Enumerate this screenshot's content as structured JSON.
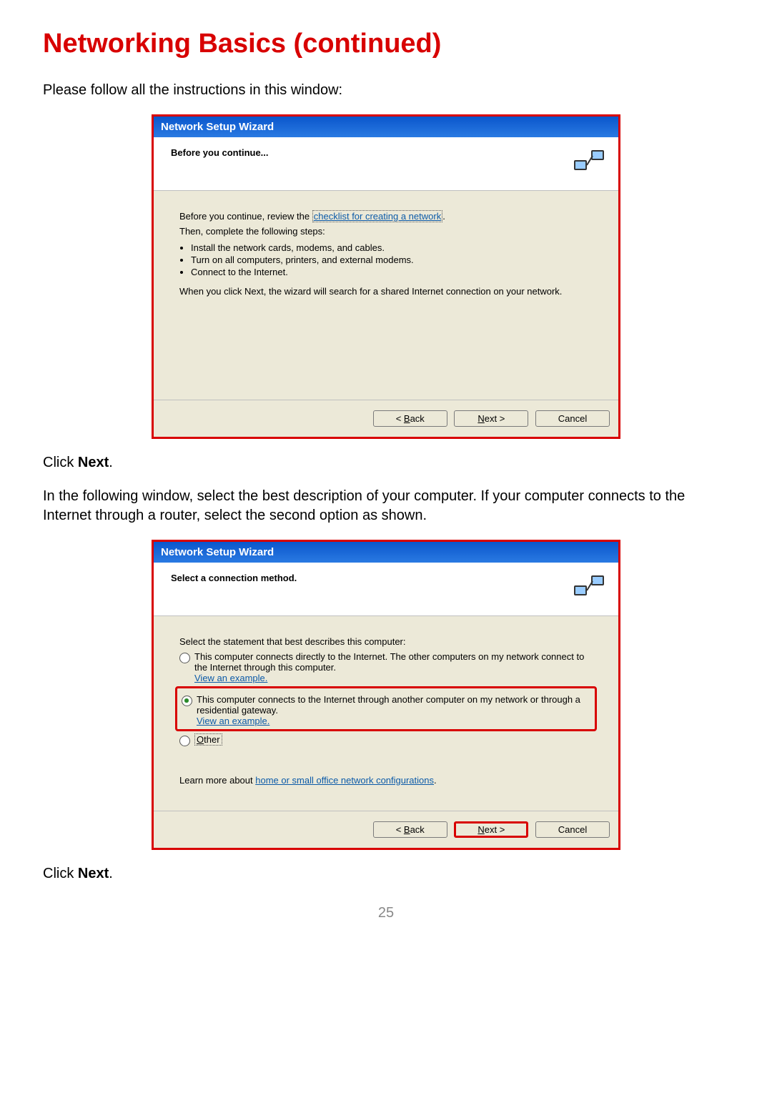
{
  "page": {
    "title": "Networking Basics (continued)",
    "intro": "Please follow all the instructions in this window:",
    "click_next_1": "Click ",
    "click_next_bold": "Next",
    "click_next_period": ".",
    "para2": "In the following window, select the best description of your computer. If your computer connects to the Internet through a router, select the second option as shown.",
    "page_number": "25"
  },
  "wizard1": {
    "titlebar": "Network Setup Wizard",
    "header": "Before you continue...",
    "line1_pre": "Before you continue, review the ",
    "line1_link": "checklist for creating a network",
    "line2": "Then, complete the following steps:",
    "bullets": [
      "Install the network cards, modems, and cables.",
      "Turn on all computers, printers, and external modems.",
      "Connect to the Internet."
    ],
    "line3": "When you click Next, the wizard will search for a shared Internet connection on your network.",
    "back": "< Back",
    "next": "Next >",
    "cancel": "Cancel"
  },
  "wizard2": {
    "titlebar": "Network Setup Wizard",
    "header": "Select a connection method.",
    "prompt": "Select the statement that best describes this computer:",
    "opt1": "This computer connects directly to the Internet. The other computers on my network connect to the Internet through this computer.",
    "opt2": "This computer connects to the Internet through another computer on my network or through a residential gateway.",
    "view_example": "View an example.",
    "opt3": "Other",
    "learn_pre": "Learn more about ",
    "learn_link": "home or small office network configurations",
    "back": "< Back",
    "next": "Next >",
    "cancel": "Cancel"
  }
}
